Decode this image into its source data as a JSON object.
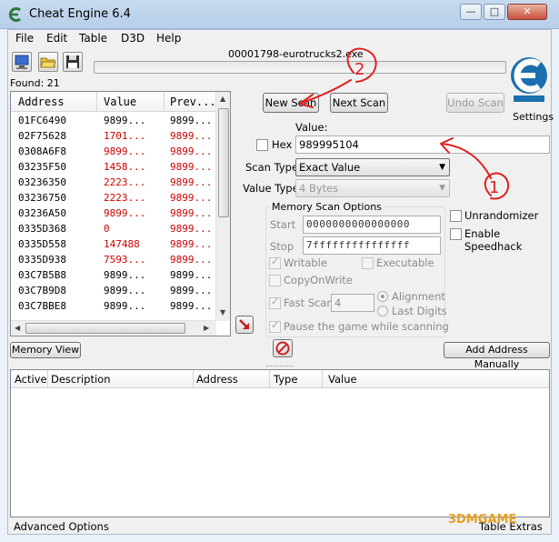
{
  "window": {
    "title": "Cheat Engine 6.4",
    "minimize_glyph": "—",
    "maximize_glyph": "□",
    "close_glyph": "✕"
  },
  "menu": [
    "File",
    "Edit",
    "Table",
    "D3D",
    "Help"
  ],
  "process": "00001798-eurotrucks2.exe",
  "found": "Found: 21",
  "settings": "Settings",
  "results": {
    "headers": [
      "Address",
      "Value",
      "Prev..."
    ],
    "rows": [
      {
        "address": "01FC6490",
        "value": "9899...",
        "prev": "9899...",
        "changed": false
      },
      {
        "address": "02F75628",
        "value": "1701...",
        "prev": "9899...",
        "changed": true
      },
      {
        "address": "0308A6F8",
        "value": "9899...",
        "prev": "9899...",
        "changed": true
      },
      {
        "address": "03235F50",
        "value": "1458...",
        "prev": "9899...",
        "changed": true
      },
      {
        "address": "03236350",
        "value": "2223...",
        "prev": "9899...",
        "changed": true
      },
      {
        "address": "03236750",
        "value": "2223...",
        "prev": "9899...",
        "changed": true
      },
      {
        "address": "03236A50",
        "value": "9899...",
        "prev": "9899...",
        "changed": true
      },
      {
        "address": "0335D368",
        "value": "0",
        "prev": "9899...",
        "changed": true
      },
      {
        "address": "0335D558",
        "value": "147488",
        "prev": "9899...",
        "changed": true
      },
      {
        "address": "0335D938",
        "value": "7593...",
        "prev": "9899...",
        "changed": true
      },
      {
        "address": "03C7B5B8",
        "value": "9899...",
        "prev": "9899...",
        "changed": false
      },
      {
        "address": "03C7B9D8",
        "value": "9899...",
        "prev": "9899...",
        "changed": false
      },
      {
        "address": "03C7BBE8",
        "value": "9899...",
        "prev": "9899...",
        "changed": false
      }
    ]
  },
  "buttons": {
    "new_scan": "New Scan",
    "next_scan": "Next Scan",
    "undo_scan": "Undo Scan",
    "memory_view": "Memory View",
    "add_address": "Add Address Manually"
  },
  "scan": {
    "value_label": "Value:",
    "hex_label": "Hex",
    "value": "989995104",
    "scan_type_label": "Scan Type",
    "scan_type": "Exact Value",
    "value_type_label": "Value Type",
    "value_type": "4 Bytes"
  },
  "memory_options": {
    "title": "Memory Scan Options",
    "start_label": "Start",
    "start": "0000000000000000",
    "stop_label": "Stop",
    "stop": "7fffffffffffffff",
    "writable": "Writable",
    "executable": "Executable",
    "copy_on_write": "CopyOnWrite",
    "fast_scan": "Fast Scan",
    "fast_scan_value": "4",
    "alignment": "Alignment",
    "last_digits": "Last Digits",
    "pause_game": "Pause the game while scanning"
  },
  "extras": {
    "unrandomizer": "Unrandomizer",
    "speedhack": "Enable Speedhack"
  },
  "address_list": {
    "headers": [
      "Active",
      "Description",
      "Address",
      "Type",
      "Value"
    ]
  },
  "status": {
    "advanced_options": "Advanced Options",
    "table_extras": "Table Extras"
  },
  "annotations": [
    "2",
    "1"
  ],
  "watermark": "3DMGAME",
  "colors": {
    "changed_value": "#cc0000",
    "annotation": "#e02020",
    "logo": "#1b6fae"
  }
}
